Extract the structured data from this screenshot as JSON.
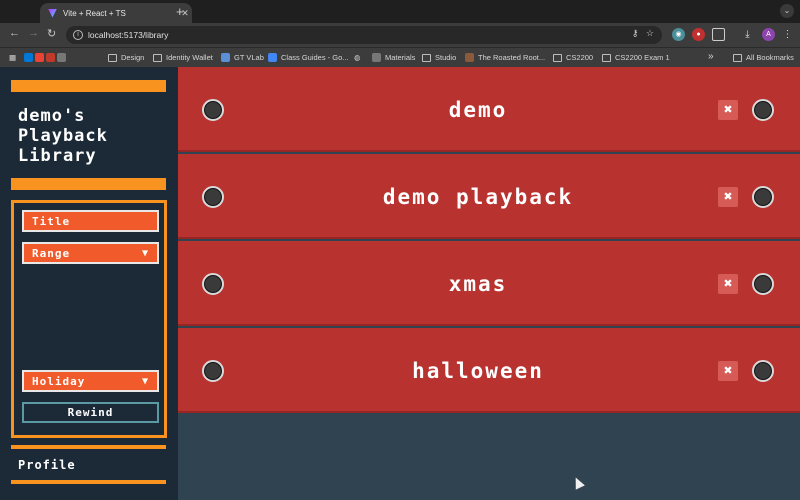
{
  "browser": {
    "tab_title": "Vite + React + TS",
    "tab_close": "✕",
    "new_tab": "+",
    "url": "localhost:5173/library",
    "nav": {
      "back": "←",
      "forward": "→",
      "reload": "↻"
    },
    "bookmarks": [
      "Design",
      "Identity Wallet",
      "GT VLab",
      "Class Guides - Go...",
      "Materials",
      "Studio",
      "The Roasted Root...",
      "CS2200",
      "CS2200 Exam 1"
    ],
    "bookmarks_overflow": "»",
    "all_bookmarks": "All Bookmarks",
    "profile_initial": "A"
  },
  "sidebar": {
    "title": "demo's Playback Library",
    "filters": {
      "title_label": "Title",
      "range_label": "Range",
      "holiday_label": "Holiday",
      "rewind_label": "Rewind",
      "arrow": "▼"
    },
    "profile_label": "Profile"
  },
  "library": {
    "items": [
      {
        "name": "demo",
        "delete": "✖"
      },
      {
        "name": "demo playback",
        "delete": "✖"
      },
      {
        "name": "xmas",
        "delete": "✖"
      },
      {
        "name": "halloween",
        "delete": "✖"
      }
    ]
  },
  "colors": {
    "accent": "#f7931e",
    "row": "#b83230",
    "sidebar": "#1b2a36",
    "main_bg": "#2f4450",
    "button": "#f15a2b"
  }
}
